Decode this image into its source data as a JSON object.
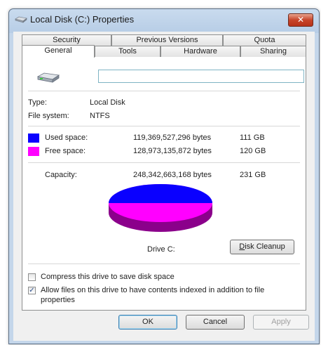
{
  "window": {
    "title": "Local Disk (C:) Properties",
    "close_glyph": "✕"
  },
  "tabs": {
    "row_top": [
      "Security",
      "Previous Versions",
      "Quota"
    ],
    "row_bottom": [
      "General",
      "Tools",
      "Hardware",
      "Sharing"
    ],
    "active": "General"
  },
  "general": {
    "drive_name_value": "",
    "type_label": "Type:",
    "type_value": "Local Disk",
    "fs_label": "File system:",
    "fs_value": "NTFS",
    "used": {
      "label": "Used space:",
      "bytes": "119,369,527,296 bytes",
      "size": "111 GB",
      "color": "#0a00ff"
    },
    "free": {
      "label": "Free space:",
      "bytes": "128,973,135,872 bytes",
      "size": "120 GB",
      "color": "#ff00ff"
    },
    "capacity": {
      "label": "Capacity:",
      "bytes": "248,342,663,168 bytes",
      "size": "231 GB"
    },
    "drive_caption": "Drive C:",
    "disk_cleanup_label": "Disk Cleanup",
    "compress_label": "Compress this drive to save disk space",
    "compress_checked": false,
    "index_label_line1": "Allow files on this drive to have contents indexed in addition to file",
    "index_label_line2": "properties",
    "index_checked": true
  },
  "footer": {
    "ok_label": "OK",
    "cancel_label": "Cancel",
    "apply_label": "Apply"
  },
  "icons": {
    "title_icon": "drive-icon",
    "drive_icon": "hard-drive-icon"
  }
}
